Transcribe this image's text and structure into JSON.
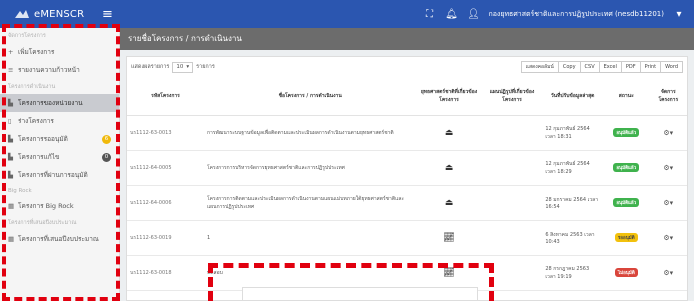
{
  "topbar": {
    "brand": "eMENSCR",
    "user": "กองยุทธศาสตร์ชาติและการปฏิรูปประเทศ (nesdb11201)"
  },
  "sidebar": {
    "sections": [
      {
        "title": "จัดการโครงการ",
        "items": [
          {
            "icon": "+",
            "label": "เพิ่มโครงการ",
            "active": false
          },
          {
            "icon": "≡",
            "label": "รายงานความก้าวหน้า",
            "active": false
          }
        ]
      },
      {
        "title": "โครงการดำเนินงาน",
        "items": [
          {
            "icon": "▙",
            "label": "โครงการของหน่วยงาน",
            "active": true
          },
          {
            "icon": "▯",
            "label": "ร่างโครงการ",
            "active": false
          },
          {
            "icon": "▙",
            "label": "โครงการรออนุมัติ",
            "badge": "6",
            "badge_color": "yellow",
            "active": false
          },
          {
            "icon": "▙",
            "label": "โครงการแก้ไข",
            "badge": "0",
            "badge_color": "grey",
            "active": false
          },
          {
            "icon": "▙",
            "label": "โครงการที่ผ่านการอนุมัติ",
            "active": false
          }
        ]
      },
      {
        "title": "Big Rock",
        "items": [
          {
            "icon": "▦",
            "label": "โครงการ Big Rock",
            "active": false
          }
        ]
      },
      {
        "title": "โครงการที่เสนอปีงบประมาณ",
        "items": [
          {
            "icon": "▦",
            "label": "โครงการที่เสนอปีงบประมาณ",
            "active": false
          }
        ]
      }
    ]
  },
  "main": {
    "title": "รายชื่อโครงการ / การดำเนินงาน",
    "length_label_pre": "แสดงผลรายการ",
    "length_value": "10",
    "length_label_post": "รายการ",
    "buttons": [
      "แสดงคอลัมน์",
      "Copy",
      "CSV",
      "Excel",
      "PDF",
      "Print",
      "Word"
    ],
    "columns": [
      "รหัสโครงการ",
      "ชื่อโครงการ / การดำเนินงาน",
      "ยุทธศาสตร์ชาติที่เกี่ยวข้องโครงการ",
      "แผนปฏิรูปที่เกี่ยวข้องโครงการ",
      "วันที่ปรับข้อมูลล่าสุด",
      "สถานะ",
      "จัดการโครงการ"
    ],
    "rows": [
      {
        "code": "นร1112-63-0013",
        "name": "การพัฒนาระบบฐานข้อมูลเพื่อติดตามและประเมินผลการดำเนินงานตามยุทธศาสตร์ชาติ",
        "ns": "stamp",
        "date": "12 กุมภาพันธ์ 2564 เวลา 18:31",
        "status": "อนุมัติแล้ว",
        "status_color": "green"
      },
      {
        "code": "นร1112-64-0005",
        "name": "โครงการการบริหารจัดการยุทธศาสตร์ชาติและการปฏิรูปประเทศ",
        "ns": "stamp",
        "date": "12 กุมภาพันธ์ 2564 เวลา 18:29",
        "status": "อนุมัติแล้ว",
        "status_color": "green"
      },
      {
        "code": "นร1112-64-0006",
        "name": "โครงการการติดตามและประเมินผลการดำเนินงานตามแผนแม่บทภายใต้ยุทธศาสตร์ชาติและแผนการปฏิรูปประเทศ",
        "ns": "stamp",
        "date": "28 มกราคม 2564 เวลา 16:54",
        "status": "อนุมัติแล้ว",
        "status_color": "green"
      },
      {
        "code": "นร1112-63-0019",
        "name": "1",
        "ns": "chart",
        "date": "6 สิงหาคม 2563 เวลา 10:43",
        "status": "รออนุมัติ",
        "status_color": "yellow"
      },
      {
        "code": "นร1112-63-0018",
        "name": "ทดสอบ",
        "ns": "chart",
        "date": "28 กรกฎาคม 2563 เวลา 19:19",
        "status": "ไม่อนุมัติ",
        "status_color": "red"
      }
    ]
  }
}
